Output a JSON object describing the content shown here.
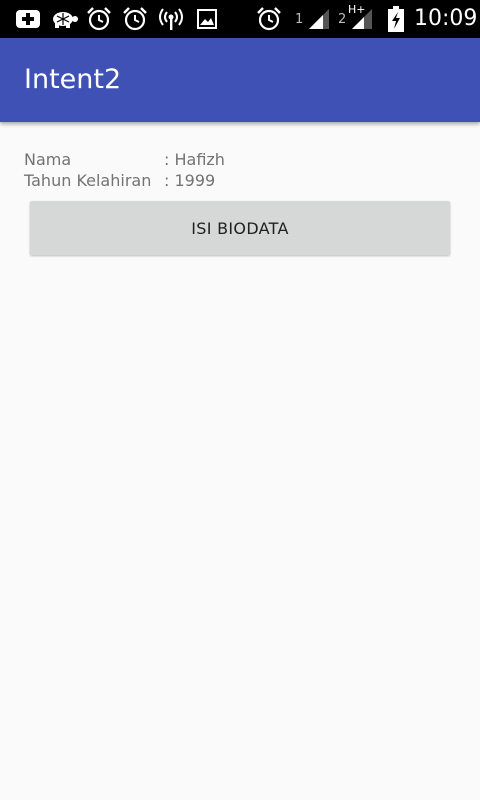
{
  "status_bar": {
    "icons": [
      "add-box-icon",
      "turtle-icon",
      "alarm-icon",
      "alarm-icon",
      "wifi-tower-icon",
      "image-icon",
      "alarm-icon",
      "signal-icon",
      "signal-icon",
      "battery-charging-icon"
    ],
    "sim1": "1",
    "sim2": "2",
    "network_type": "H+",
    "time": "10:09"
  },
  "app_bar": {
    "title": "Intent2",
    "color": "#3f51b5"
  },
  "biodata": {
    "name_label": "Nama",
    "name_value": ": Hafizh",
    "year_label": "Tahun Kelahiran",
    "year_value": ": 1999"
  },
  "button": {
    "label": "ISI BIODATA"
  }
}
